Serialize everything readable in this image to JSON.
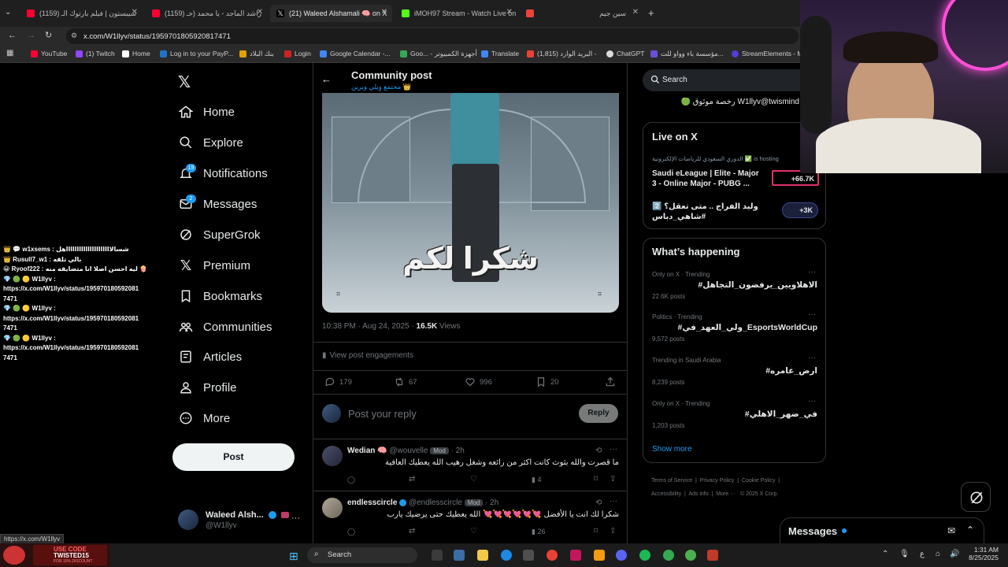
{
  "browser": {
    "tabs": [
      {
        "title": "(1159) سيبستون | فيلم بارتوك الـ",
        "color": "#ff0033"
      },
      {
        "title": "(1159) راشد الماجد - يا محمد (حـ",
        "color": "#ff0033"
      },
      {
        "title": "(21) Waleed Alshamali 🧠 on X",
        "color": "#ffffff"
      },
      {
        "title": "iMOH97 Stream - Watch Live on",
        "color": "#53fc18"
      },
      {
        "title": "",
        "color": "#e8453c"
      },
      {
        "title": "سين جيم",
        "color": "#888888"
      }
    ],
    "new_tab": "+",
    "url": "x.com/W1llyv/status/1959701805920817471",
    "bookmarks": [
      {
        "label": "YouTube",
        "color": "#ff0033"
      },
      {
        "label": "(1) Twitch",
        "color": "#9146ff"
      },
      {
        "label": "Home",
        "color": "#ffffff"
      },
      {
        "label": "Log in to your PayP...",
        "color": "#1d73c9"
      },
      {
        "label": "بنك البلاد",
        "color": "#e0a100"
      },
      {
        "label": "Login",
        "color": "#cc2222"
      },
      {
        "label": "Google Calendar -...",
        "color": "#4285f4"
      },
      {
        "label": "Goo... - أجهزة الكمبيوتر",
        "color": "#34a853"
      },
      {
        "label": "Translate",
        "color": "#4285f4"
      },
      {
        "label": "(1,815) البريد الوارد -",
        "color": "#ea4335"
      },
      {
        "label": "ChatGPT",
        "color": "#dddddd"
      },
      {
        "label": "مؤسسة باء وواو للت...",
        "color": "#6a4fd8"
      },
      {
        "label": "StreamElements - M",
        "color": "#4f3fd8"
      }
    ]
  },
  "nav": {
    "items": [
      {
        "label": "Home",
        "icon": "home-icon"
      },
      {
        "label": "Explore",
        "icon": "search-icon"
      },
      {
        "label": "Notifications",
        "icon": "bell-icon",
        "badge": "19"
      },
      {
        "label": "Messages",
        "icon": "mail-icon",
        "badge": "2"
      },
      {
        "label": "SuperGrok",
        "icon": "grok-icon"
      },
      {
        "label": "Premium",
        "icon": "x-logo-icon"
      },
      {
        "label": "Bookmarks",
        "icon": "bookmark-icon"
      },
      {
        "label": "Communities",
        "icon": "communities-icon"
      },
      {
        "label": "Articles",
        "icon": "articles-icon"
      },
      {
        "label": "Profile",
        "icon": "person-icon"
      },
      {
        "label": "More",
        "icon": "more-circle-icon"
      }
    ],
    "post_button": "Post",
    "account_name": "Waleed Alsh...",
    "account_handle": "@W1llyv",
    "more_dots": "···"
  },
  "post": {
    "header_title": "Community post",
    "header_subtitle": "مجتمع وِيلي ويرين 👑",
    "image_text": "شكرا لكم",
    "timestamp": "10:38 PM · Aug 24, 2025 · ",
    "views_count": "16.5K",
    "views_label": " Views",
    "engagements": "View post engagements",
    "replies": "179",
    "reposts": "67",
    "likes": "996",
    "bookmarks": "20",
    "reply_placeholder": "Post your reply",
    "reply_button": "Reply"
  },
  "replies": [
    {
      "name": "Wedian 🧠",
      "handle": "@wouvelle",
      "badge": "Mod",
      "time": "· 2h",
      "text": "ما قصرت والله بثوث كانت اكثر من رائعه وشغل رهيب الله يعطيك العافية",
      "likes": "",
      "views": "4"
    },
    {
      "name": "endlesscircle",
      "handle": "@endlesscircle",
      "badge": "Mod",
      "time": "· 2h",
      "text": "شكرا لك انت يا الأفضل 💘💘💘💘💘💘 الله يعطيك حتى يرضيك يارب",
      "likes": "",
      "views": "26"
    }
  ],
  "right": {
    "search_placeholder": "Search",
    "top_snippet": "W1llyv@twismind رخصة موثوق 🟢",
    "live": {
      "title": "Live on X",
      "host_line": "الدوري السعودي للرياضات الإلكترونية ✅ is hosting",
      "stream_title": "Saudi eLeague | Elite - Major 3 - Online Major - PUBG ...",
      "stream_count": "+66.7K",
      "second_title": "وليد الفراج .. متى تعقل؟ 2️⃣ #شاهي_دباس",
      "second_count": "+3K"
    },
    "happening": {
      "title": "What’s happening",
      "trends": [
        {
          "context": "Only on X · Trending",
          "name": "#الاهلاويين_يرفضون_التجاهل",
          "count": "22.6K posts"
        },
        {
          "context": "Politics · Trending",
          "name": "#ولي_العهد_في_EsportsWorldCup",
          "count": "9,572 posts"
        },
        {
          "context": "Trending in Saudi Arabia",
          "name": "#ارض_عامره",
          "count": "8,239 posts"
        },
        {
          "context": "Only on X · Trending",
          "name": "#في_ضهر_الاهلي",
          "count": "1,203 posts"
        }
      ],
      "show_more": "Show more"
    },
    "footer": [
      "Terms of Service",
      "Privacy Policy",
      "Cookie Policy",
      "Accessibility",
      "Ads info",
      "More ···",
      "© 2025 X Corp."
    ],
    "messages_label": "Messages"
  },
  "chat": {
    "lines": [
      "👑 💬 w1xsems : شسالاااااااااااااااااااااهل",
      "👑 Rusull7_w1 : بالي تلقه",
      "😀 Ryoof222 : ليه احسن اصلا انا متضايقه منه 🍿",
      "💎 🟢 🟡 W1llyv :",
      "https://x.com/W1llyv/status/195970180592081",
      "7471",
      "💎 🟢 🟡 W1llyv :",
      "https://x.com/W1llyv/status/195970180592081",
      "7471",
      "💎 🟢 🟡 W1llyv :",
      "https://x.com/W1llyv/status/195970180592081",
      "7471"
    ]
  },
  "status_url": "https://x.com/W1llyv",
  "promo": {
    "line1": "USE CODE",
    "line2": "TWISTED15",
    "line3": "FOR 15% DISCOUNT"
  },
  "taskbar": {
    "search_label": "Search",
    "time": "1:31 AM",
    "date": "8/25/2025",
    "lang": "ع"
  }
}
